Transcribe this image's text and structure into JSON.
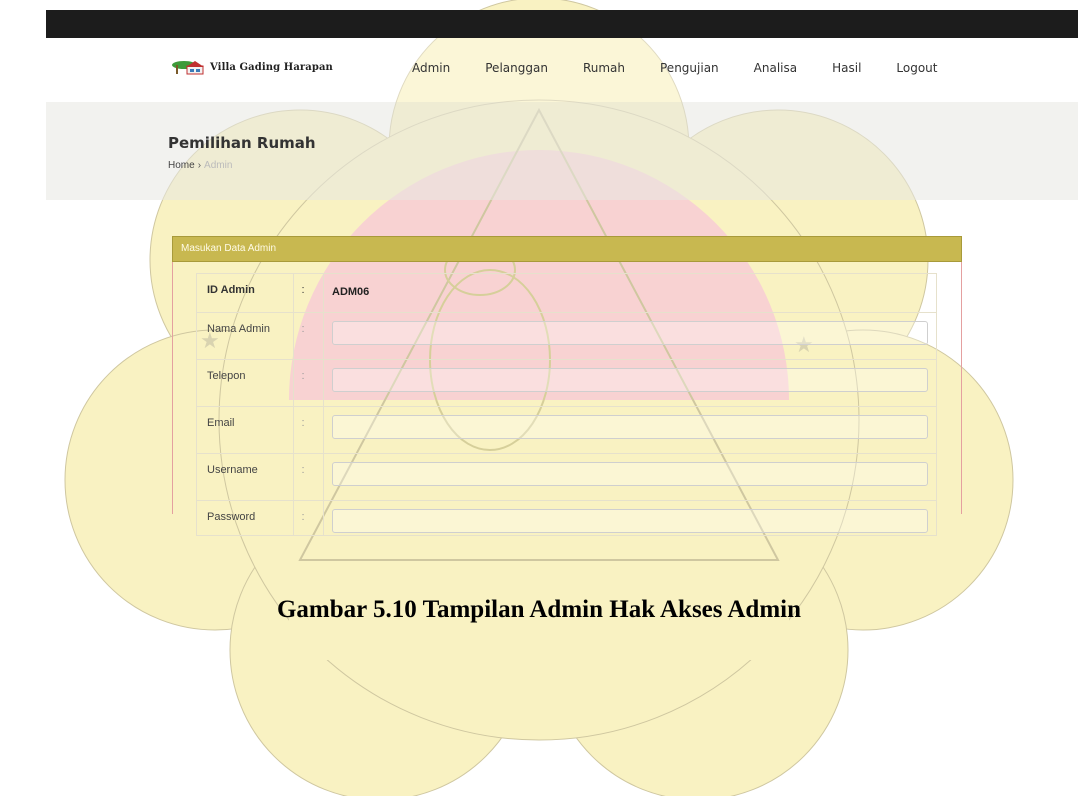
{
  "app": {
    "brand": "Villa Gading Harapan",
    "nav": [
      "Admin",
      "Pelanggan",
      "Rumah",
      "Pengujian",
      "Analisa",
      "Hasil",
      "Logout"
    ]
  },
  "banner": {
    "title": "Pemilihan Rumah",
    "breadcrumb": {
      "home": "Home",
      "sep": "›",
      "current": "Admin"
    }
  },
  "panel": {
    "header": "Masukan Data Admin",
    "id_row": {
      "label": "ID Admin",
      "colon": ":",
      "value": "ADM06"
    },
    "fields": [
      {
        "label": "Nama Admin",
        "colon": ":",
        "value": ""
      },
      {
        "label": "Telepon",
        "colon": ":",
        "value": ""
      },
      {
        "label": "Email",
        "colon": ":",
        "value": ""
      },
      {
        "label": "Username",
        "colon": ":",
        "value": ""
      },
      {
        "label": "Password",
        "colon": ":",
        "value": ""
      }
    ]
  },
  "caption": "Gambar 5.10 Tampilan Admin Hak Akses Admin",
  "colors": {
    "topbar": "#1c1c1c",
    "panel_header": "#c8b850",
    "panel_border": "#e4a0a0",
    "watermark_yellow": "#f7efb0",
    "watermark_red": "#f6c9c9"
  }
}
